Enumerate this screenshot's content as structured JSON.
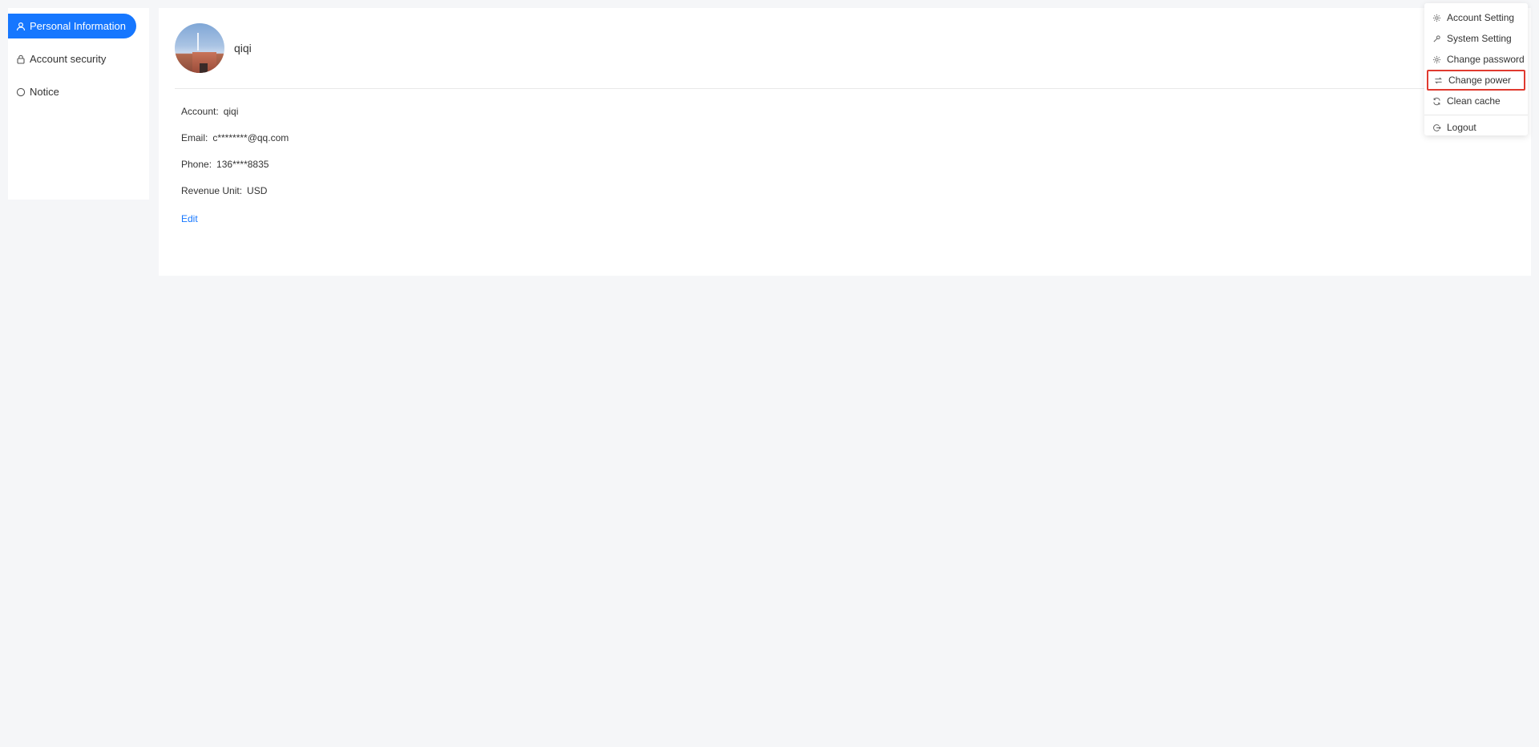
{
  "sidebar": {
    "items": [
      {
        "label": "Personal Information",
        "icon": "user-icon",
        "active": true
      },
      {
        "label": "Account security",
        "icon": "lock-icon",
        "active": false
      },
      {
        "label": "Notice",
        "icon": "bell-icon",
        "active": false
      }
    ]
  },
  "profile": {
    "username": "qiqi",
    "fields": [
      {
        "label": "Account:",
        "value": "qiqi"
      },
      {
        "label": "Email:",
        "value": "c********@qq.com"
      },
      {
        "label": "Phone:",
        "value": "136****8835"
      },
      {
        "label": "Revenue Unit:",
        "value": "USD"
      }
    ],
    "edit_label": "Edit"
  },
  "dropdown": {
    "items": [
      {
        "label": "Account Setting",
        "icon": "gear-icon"
      },
      {
        "label": "System Setting",
        "icon": "wrench-icon"
      },
      {
        "label": "Change password",
        "icon": "gear-icon"
      },
      {
        "label": "Change power",
        "icon": "swap-icon"
      },
      {
        "label": "Clean cache",
        "icon": "refresh-icon"
      },
      {
        "label": "Logout",
        "icon": "logout-icon"
      }
    ]
  },
  "colors": {
    "accent": "#1677ff",
    "highlight_border": "#e03a2f",
    "background": "#f5f6f8"
  }
}
